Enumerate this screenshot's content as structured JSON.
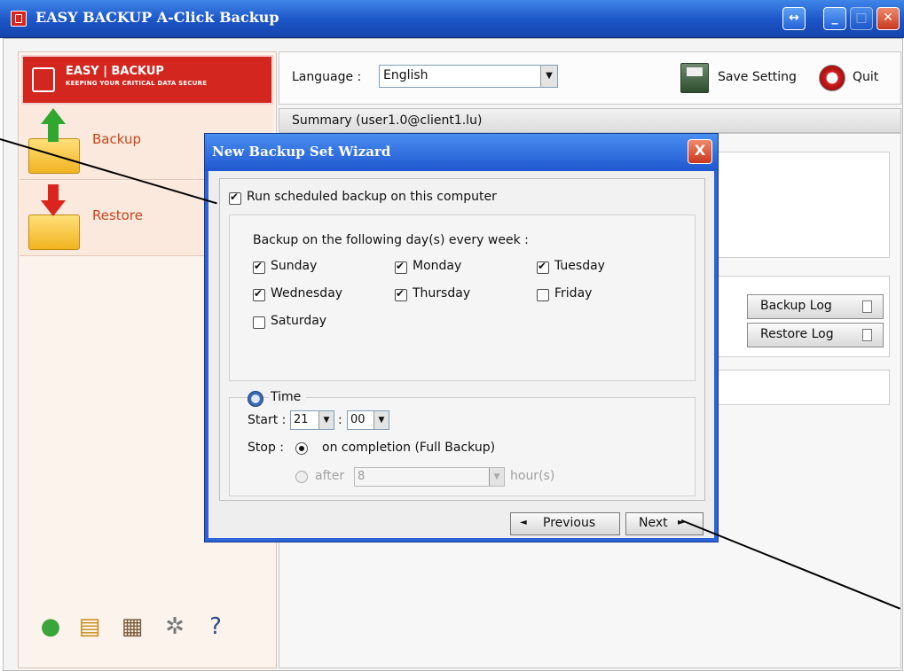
{
  "window": {
    "title": "EASY BACKUP A-Click Backup"
  },
  "logo": {
    "brand": "EASY | BACKUP",
    "tagline": "KEEPING YOUR CRITICAL DATA SECURE"
  },
  "nav": {
    "backup": "Backup",
    "restore": "Restore"
  },
  "topbar": {
    "language_label": "Language :",
    "language_value": "English",
    "save_label": "Save Setting",
    "quit_label": "Quit"
  },
  "summary": {
    "title": "Summary (user1.0@client1.lu)"
  },
  "logs": {
    "backup_log": "Backup Log",
    "restore_log": "Restore Log"
  },
  "wizard": {
    "title": "New Backup Set Wizard",
    "close": "X",
    "run_scheduled_label": "Run scheduled backup on this computer",
    "days_heading": "Backup on the following day(s) every week :",
    "days": [
      {
        "label": "Sunday",
        "checked": true
      },
      {
        "label": "Monday",
        "checked": true
      },
      {
        "label": "Tuesday",
        "checked": true
      },
      {
        "label": "Wednesday",
        "checked": true
      },
      {
        "label": "Thursday",
        "checked": true
      },
      {
        "label": "Friday",
        "checked": false
      },
      {
        "label": "Saturday",
        "checked": false
      }
    ],
    "time": {
      "legend": "Time",
      "start_label": "Start :",
      "start_hour": "21",
      "start_colon": ":",
      "start_minute": "00",
      "stop_label": "Stop :",
      "stop_option_completion": "on completion (Full Backup)",
      "stop_option_after": "after",
      "stop_after_value": "8",
      "stop_after_unit": "hour(s)"
    },
    "previous_label": "Previous",
    "next_label": "Next"
  }
}
